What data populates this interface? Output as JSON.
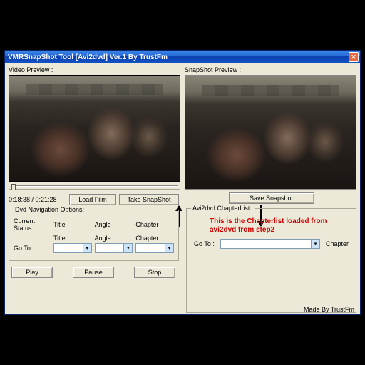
{
  "window": {
    "title": "VMRSnapShot Tool [Avi2dvd] Ver.1 By TrustFm"
  },
  "labels": {
    "video_preview": "Video Preview :",
    "snapshot_preview": "SnapShot Preview :",
    "timecode": "0:18:38 / 0:21:28",
    "load_film": "Load Film",
    "take_snapshot": "Take SnapShot",
    "save_snapshot": "Save Snapshot",
    "dvd_nav_title": "Dvd Navigation Options:",
    "current_status": "Current Status:",
    "title": "Title",
    "angle": "Angle",
    "chapter": "Chapter",
    "goto": "Go To :",
    "play": "Play",
    "pause": "Pause",
    "stop": "Stop",
    "chapterlist_title": "Avi2dvd ChapterList :",
    "chapter_note_l1": "This is the Chapterlist loaded from",
    "chapter_note_l2": "avi2dvd from step2",
    "chapter_suffix": "Chapter",
    "footer": "Made By TrustFm"
  }
}
